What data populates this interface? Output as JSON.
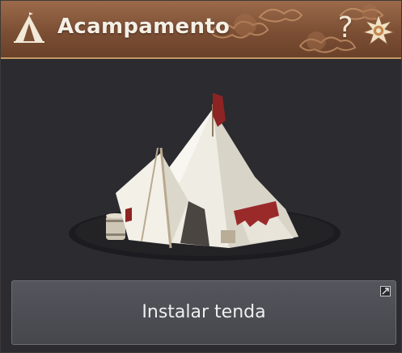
{
  "window": {
    "title": "Acampamento",
    "title_icon": "camp-tent-icon",
    "help_label": "?",
    "settings_icon": "sun-emblem-icon"
  },
  "content": {
    "image": "tent-illustration"
  },
  "action": {
    "label": "Instalar tenda",
    "corner_icon": "expand-corner-icon"
  },
  "colors": {
    "titlebar": "#7c4f34",
    "titlebar_trim": "#c59a63",
    "panel": "#2b2b30",
    "button": "#4c4e54",
    "text": "#efefef"
  }
}
